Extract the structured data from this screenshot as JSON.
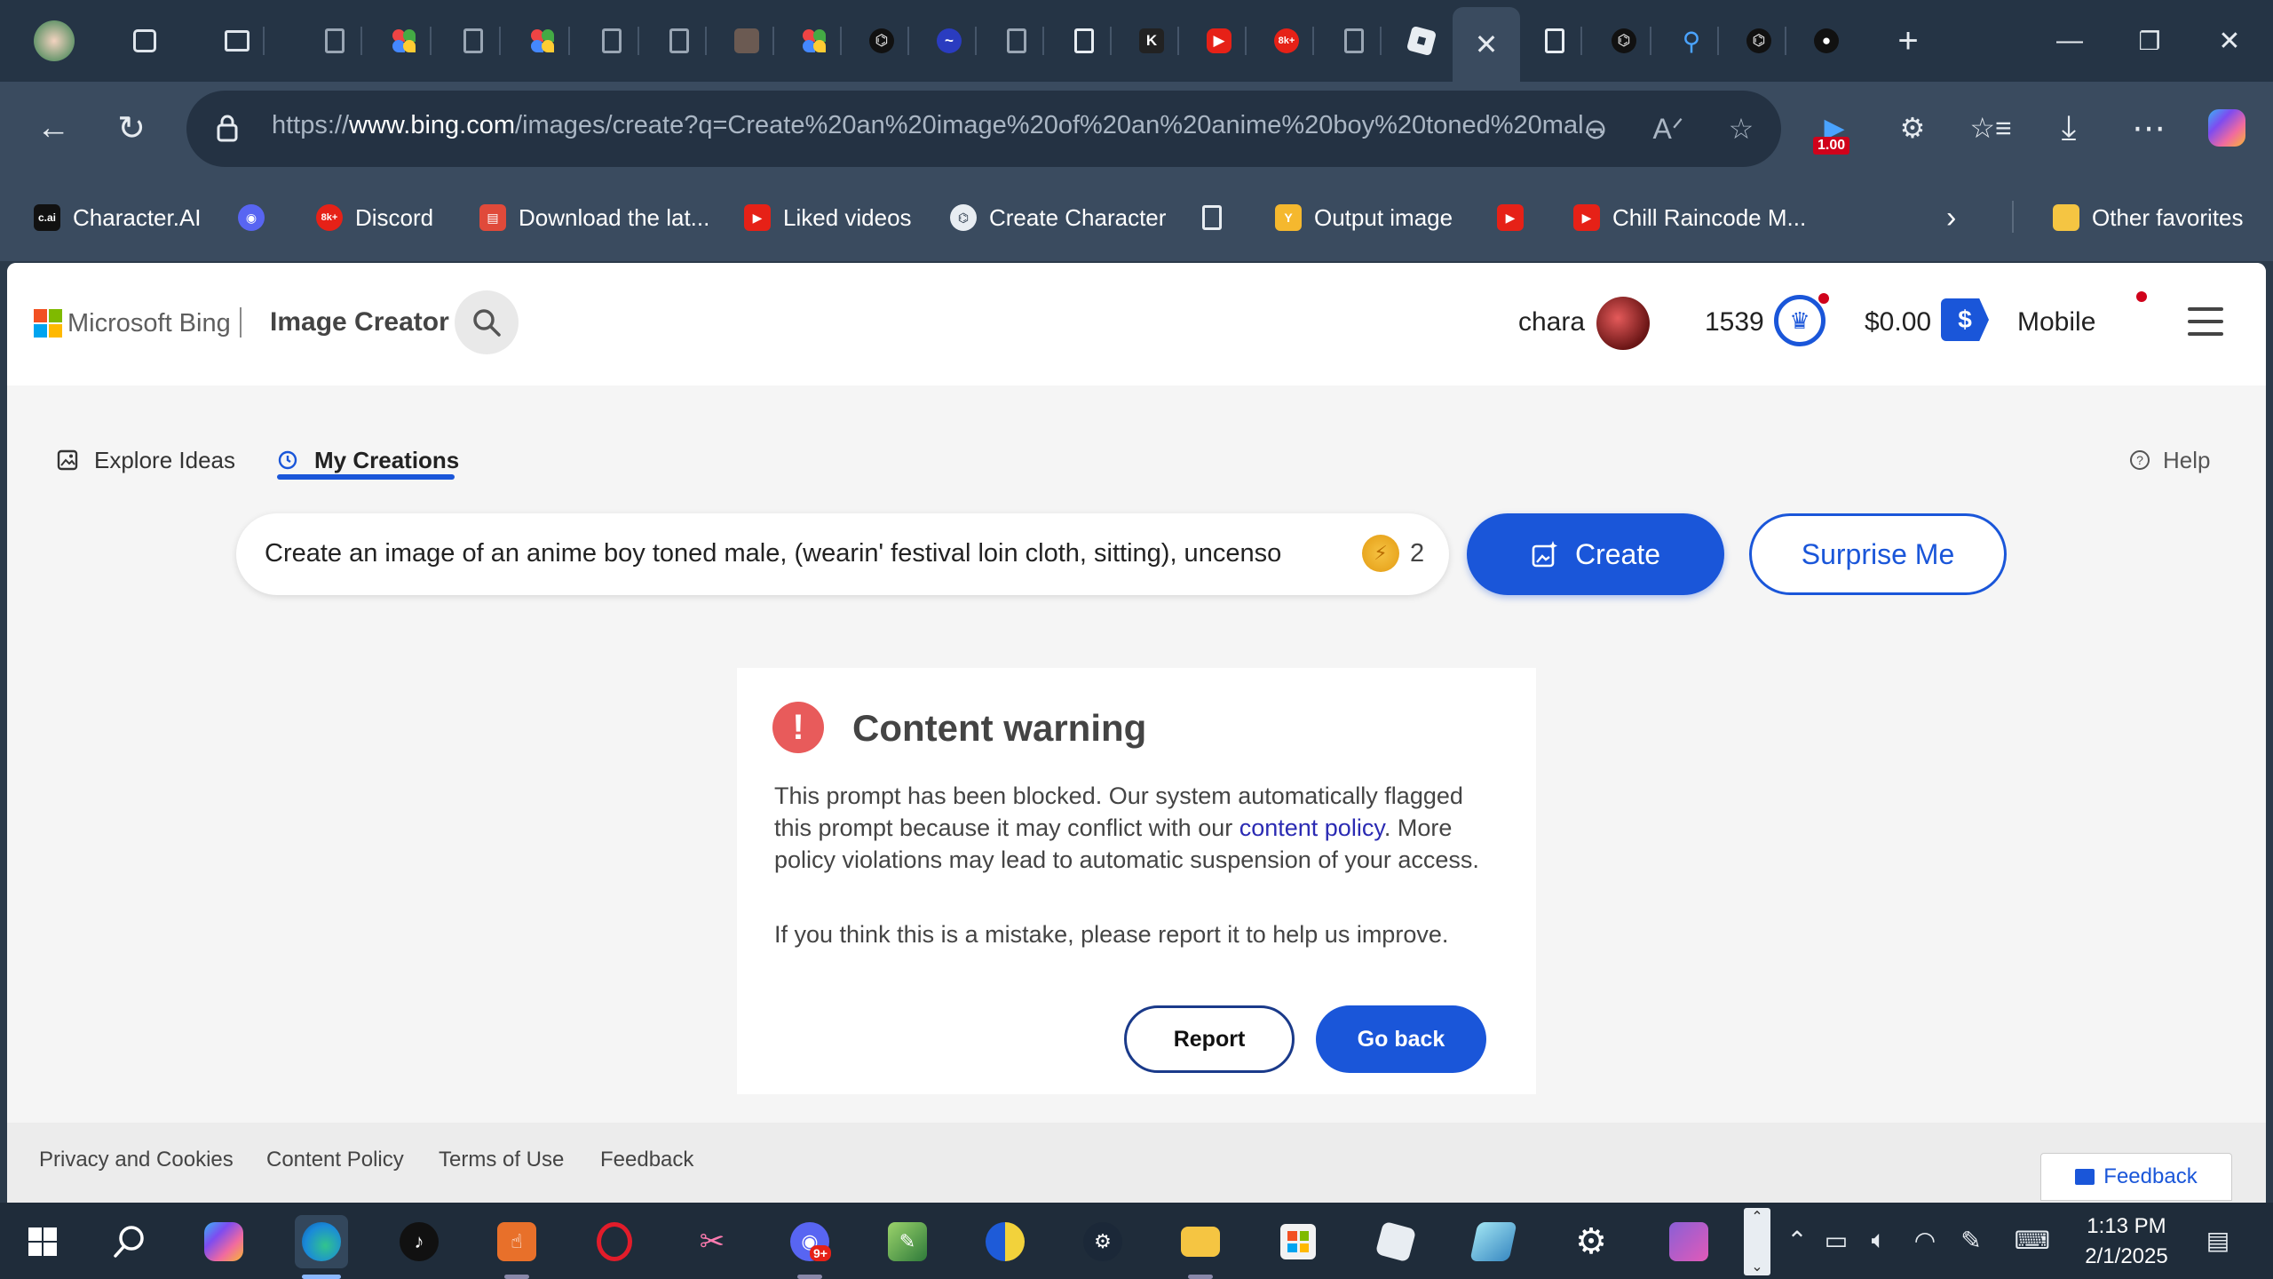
{
  "browser": {
    "url_prefix": "https://",
    "url_domain": "www.bing.com",
    "url_rest": "/images/create?q=Create%20an%20image%20of%20an%20anime%20boy%20toned%20mal...",
    "tabs_active_index": 15,
    "tab_badge_8k": "8k+",
    "extension_badge": "1.00"
  },
  "favorites": [
    {
      "label": "Character.AI",
      "icon": "c.ai"
    },
    {
      "label": "",
      "icon": "discord-icon"
    },
    {
      "label": "Discord",
      "icon": "8k+"
    },
    {
      "label": "Download the lat...",
      "icon": "store-icon"
    },
    {
      "label": "Liked videos",
      "icon": "youtube-icon"
    },
    {
      "label": "Create Character",
      "icon": "openai-icon"
    },
    {
      "label": "",
      "icon": "document-icon"
    },
    {
      "label": "Output image",
      "icon": "y-icon"
    },
    {
      "label": "",
      "icon": "youtube-icon"
    },
    {
      "label": "Chill Raincode M...",
      "icon": "youtube-icon"
    }
  ],
  "favorites_other": "Other favorites",
  "header": {
    "brand": "Microsoft Bing",
    "app_name": "Image Creator",
    "user_name": "chara",
    "points": "1539",
    "money": "$0.00",
    "money_badge": "$",
    "mobile": "Mobile"
  },
  "nav": {
    "explore": "Explore Ideas",
    "creations": "My Creations",
    "help": "Help"
  },
  "prompt": {
    "text": "Create an image of an anime boy toned male, (wearin' festival loin cloth, sitting), uncenso",
    "boost_count": "2",
    "create_label": "Create",
    "surprise_label": "Surprise Me"
  },
  "warning": {
    "title": "Content warning",
    "body_before": "This prompt has been blocked. Our system automatically flagged this prompt because it may conflict with our ",
    "body_link": "content policy",
    "body_after": ". More policy violations may lead to automatic suspension of your access.",
    "body2": "If you think this is a mistake, please report it to help us improve.",
    "report_label": "Report",
    "goback_label": "Go back"
  },
  "footer": {
    "links": [
      "Privacy and Cookies",
      "Content Policy",
      "Terms of Use",
      "Feedback"
    ],
    "feedback_button": "Feedback"
  },
  "taskbar": {
    "time": "1:13 PM",
    "date": "2/1/2025",
    "discord_badge": "9+"
  },
  "colors": {
    "accent": "#1a56d9",
    "warning": "#e85b5b",
    "chrome_dark": "#253445",
    "chrome": "#3a4b5f"
  }
}
